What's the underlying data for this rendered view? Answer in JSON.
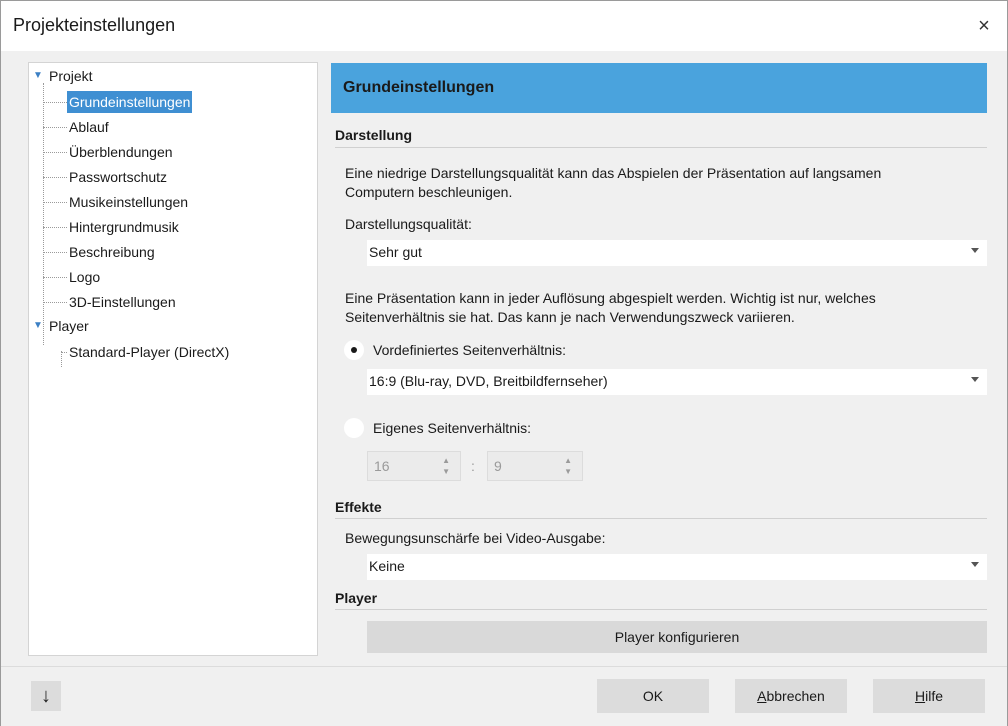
{
  "window": {
    "title": "Projekteinstellungen",
    "close_glyph": "×"
  },
  "tree": {
    "projekt": "Projekt",
    "projekt_children": [
      "Grundeinstellungen",
      "Ablauf",
      "Überblendungen",
      "Passwortschutz",
      "Musikeinstellungen",
      "Hintergrundmusik",
      "Beschreibung",
      "Logo",
      "3D-Einstellungen"
    ],
    "player": "Player",
    "player_children": [
      "Standard-Player (DirectX)"
    ],
    "selected": "Grundeinstellungen"
  },
  "panel": {
    "header": "Grundeinstellungen",
    "darstellung": {
      "title": "Darstellung",
      "desc_line1": "Eine niedrige Darstellungsqualität kann das Abspielen der Präsentation auf langsamen",
      "desc_line2": "Computern beschleunigen.",
      "quality_label": "Darstellungsqualität:",
      "quality_value": "Sehr gut",
      "aspect_desc_line1": "Eine Präsentation kann in jeder Auflösung abgespielt werden. Wichtig ist nur, welches",
      "aspect_desc_line2": "Seitenverhältnis sie hat. Das kann je nach Verwendungszweck variieren.",
      "predefined_label": "Vordefiniertes Seitenverhältnis:",
      "predefined_value": "16:9 (Blu-ray, DVD, Breitbildfernseher)",
      "custom_label": "Eigenes Seitenverhältnis:",
      "custom_width": "16",
      "custom_sep": ":",
      "custom_height": "9",
      "selected_option": "predefined"
    },
    "effekte": {
      "title": "Effekte",
      "motion_blur_label": "Bewegungsunschärfe bei Video-Ausgabe:",
      "motion_blur_value": "Keine"
    },
    "player": {
      "title": "Player",
      "configure_button": "Player konfigurieren"
    }
  },
  "footer": {
    "down_glyph": "↓",
    "ok": "OK",
    "cancel_prefix": "",
    "cancel_accel": "A",
    "cancel_rest": "bbrechen",
    "help_accel": "H",
    "help_rest": "ilfe"
  },
  "colors": {
    "accent": "#4aa3dd",
    "selection": "#3f8fd2"
  }
}
